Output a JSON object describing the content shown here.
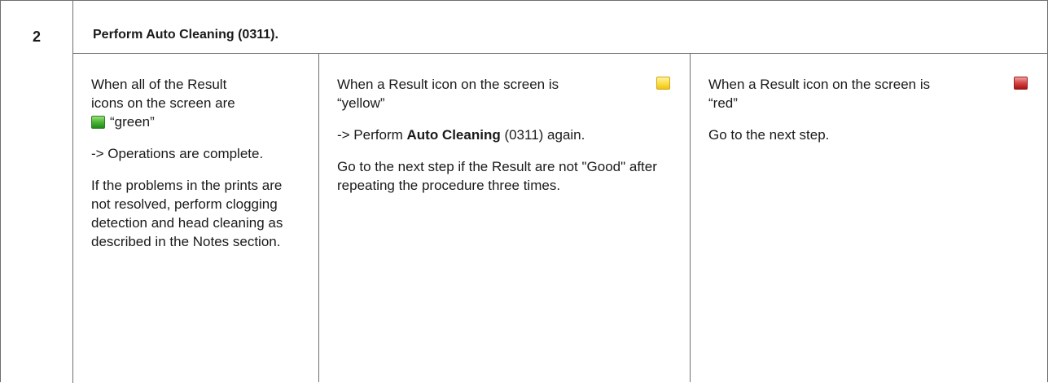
{
  "step_number": "2",
  "heading": "Perform Auto Cleaning (0311).",
  "icon_colors": {
    "green": "#4fb83a",
    "yellow": "#fbe04a",
    "red": "#d84a4a",
    "border": "#6f6f6f"
  },
  "columns": [
    {
      "condition_line1": "When all of the Result",
      "condition_line2": "icons on the screen are",
      "condition_value": "“green”",
      "icon": "green-result-icon",
      "result": "-> Operations are complete.",
      "note": "If the problems in the prints are not resolved, perform clogging detection and head cleaning as described in the Notes section."
    },
    {
      "condition_line1": "When a Result icon on the screen is",
      "condition_value": "“yellow”",
      "icon": "yellow-result-icon",
      "action_prefix": "-> Perform ",
      "action_bold": "Auto Cleaning",
      "action_suffix": " (0311) again.",
      "note": "Go to the next step if the Result are not \"Good\" after repeating the procedure three times."
    },
    {
      "condition_line1": "When a Result icon on the screen is",
      "condition_value": "“red”",
      "icon": "red-result-icon",
      "note": "Go to the next step."
    }
  ]
}
